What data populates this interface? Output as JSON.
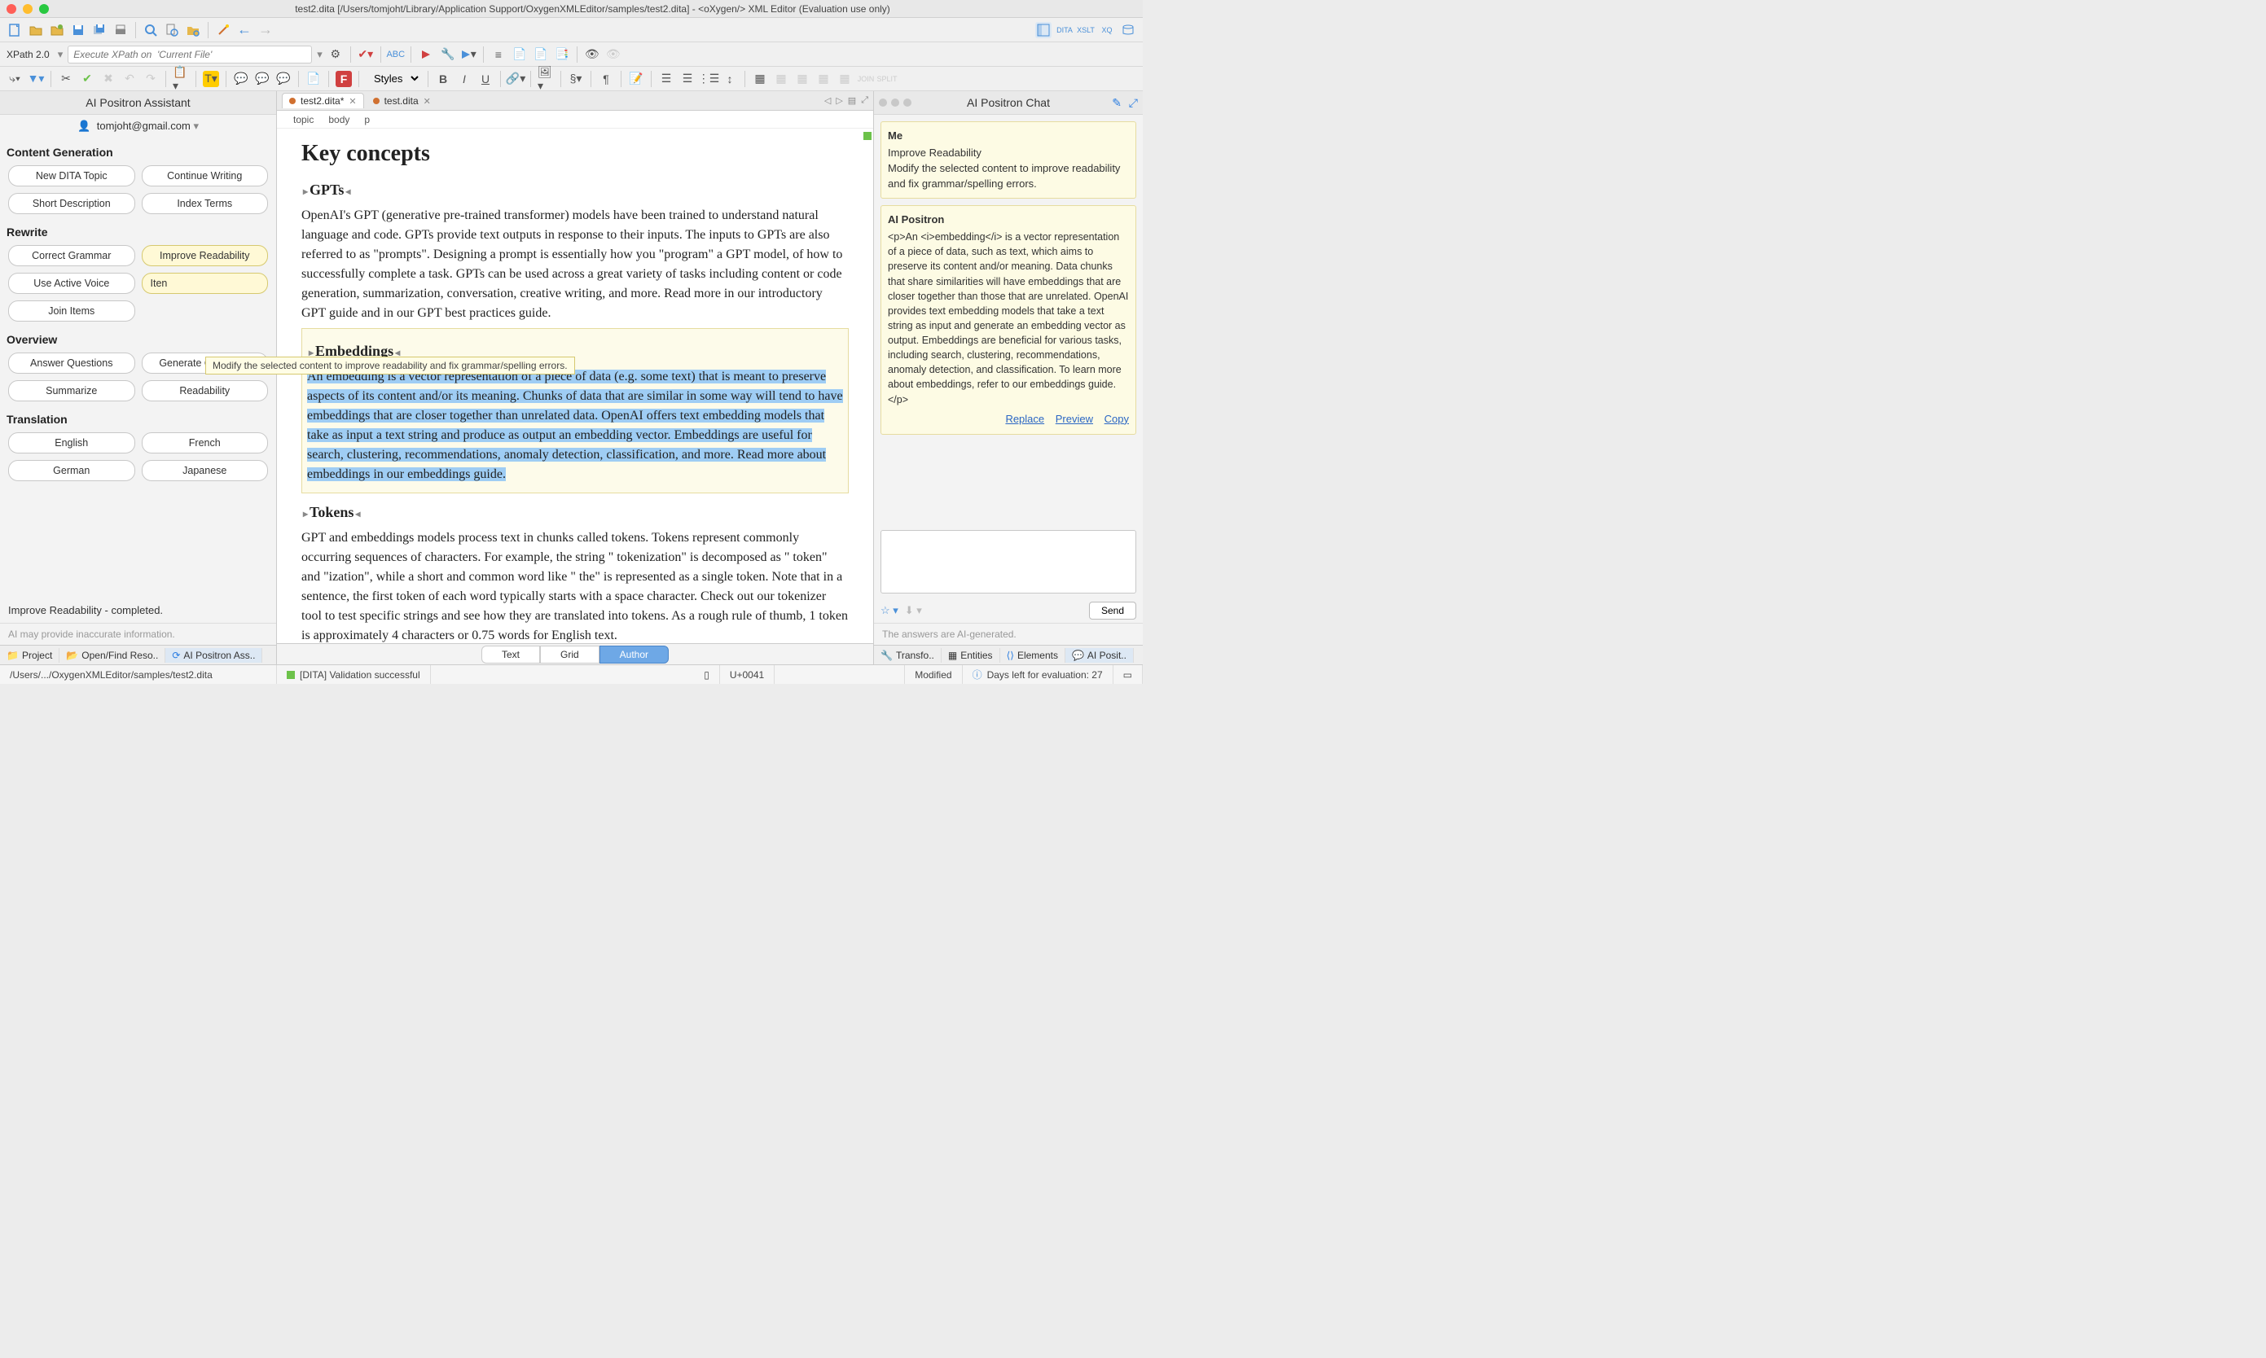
{
  "window": {
    "title": "test2.dita [/Users/tomjoht/Library/Application Support/OxygenXMLEditor/samples/test2.dita] - <oXygen/> XML Editor (Evaluation use only)"
  },
  "toolbar2": {
    "xpath_label": "XPath 2.0",
    "xpath_placeholder": "Execute XPath on  'Current File'",
    "styles_label": "Styles"
  },
  "left_panel": {
    "title": "AI Positron Assistant",
    "user": "tomjoht@gmail.com",
    "sections": {
      "content_generation": {
        "title": "Content Generation",
        "buttons": [
          "New DITA Topic",
          "Continue Writing",
          "Short Description",
          "Index Terms"
        ]
      },
      "rewrite": {
        "title": "Rewrite",
        "buttons": [
          "Correct Grammar",
          "Improve Readability",
          "Use Active Voice",
          "Iten",
          "Join Items"
        ]
      },
      "overview": {
        "title": "Overview",
        "buttons": [
          "Answer Questions",
          "Generate Questions",
          "Summarize",
          "Readability"
        ]
      },
      "translation": {
        "title": "Translation",
        "buttons": [
          "English",
          "French",
          "German",
          "Japanese"
        ]
      }
    },
    "tooltip": "Modify the selected content to improve readability and fix grammar/spelling errors.",
    "status": "Improve Readability - completed.",
    "disclaimer": "AI may provide inaccurate information."
  },
  "left_tabs": {
    "project": "Project",
    "openfind": "Open/Find Reso..",
    "assistant": "AI Positron Ass.."
  },
  "editor": {
    "tabs": [
      {
        "name": "test2.dita*",
        "modified": true,
        "active": true
      },
      {
        "name": "test.dita",
        "modified": true,
        "active": false
      }
    ],
    "breadcrumb": [
      "topic",
      "body",
      "p"
    ],
    "h1": "Key concepts",
    "sect1_title": "GPTs",
    "sect1_body": "OpenAI's GPT (generative pre-trained transformer) models have been trained to understand natural language and code. GPTs provide text outputs in response to their inputs. The inputs to GPTs are also referred to as \"prompts\". Designing a prompt is essentially how you \"program\" a GPT model, ",
    "sect1_body_tail": " of how to successfully complete a task. GPTs can be used across a great variety of tasks including content or code generation, summarization, conversation, creative writing, and more. Read more in our introductory GPT guide and in our GPT best practices guide.",
    "sect2_title": "Embeddings",
    "sect2_body": "An embedding is a vector representation of a piece of data (e.g. some text) that is meant to preserve aspects of its content and/or its meaning. Chunks of data that are similar in some way will tend to have embeddings that are closer together than unrelated data. OpenAI offers text embedding models that take as input a text string and produce as output an embedding vector. Embeddings are useful for search, clustering, recommendations, anomaly detection, classification, and more. Read more about embeddings in our embeddings guide.",
    "sect3_title": "Tokens",
    "sect3_body": "GPT and embeddings models process text in chunks called tokens. Tokens represent commonly occurring sequences of characters. For example, the string \" tokenization\" is decomposed as \" token\" and \"ization\", while a short and common word like \" the\" is represented as a single token. Note that in a sentence, the first token of each word typically starts with a space character. Check out our tokenizer tool to test specific strings and see how they are translated into tokens. As a rough rule of thumb, 1 token is approximately 4 characters or 0.75 words for English text.",
    "mode_buttons": [
      "Text",
      "Grid",
      "Author"
    ],
    "mode_active": "Author"
  },
  "chat": {
    "title": "AI Positron Chat",
    "msg1": {
      "who": "Me",
      "line1": "Improve Readability",
      "line2": "Modify the selected content to improve readability and fix grammar/spelling errors."
    },
    "msg2": {
      "who": "AI Positron",
      "body": "<p>An <i>embedding</i> is a vector representation of a piece of data, such as text, which aims to preserve its content and/or meaning. Data chunks that share similarities will have embeddings that are closer together than those that are unrelated. OpenAI provides text embedding models that take a text string as input and generate an embedding vector as output. Embeddings are beneficial for various tasks, including search, clustering, recommendations, anomaly detection, and classification. To learn more about embeddings, refer to our embeddings guide.</p>",
      "actions": [
        "Replace",
        "Preview",
        "Copy"
      ]
    },
    "send": "Send",
    "disclaimer": "The answers are AI-generated."
  },
  "right_tabs": {
    "transfo": "Transfo..",
    "entities": "Entities",
    "elements": "Elements",
    "aiposit": "AI Posit.."
  },
  "status": {
    "path": "/Users/.../OxygenXMLEditor/samples/test2.dita",
    "validation": "[DITA] Validation successful",
    "unicode": "U+0041",
    "modified": "Modified",
    "eval": "Days left for evaluation: 27"
  }
}
